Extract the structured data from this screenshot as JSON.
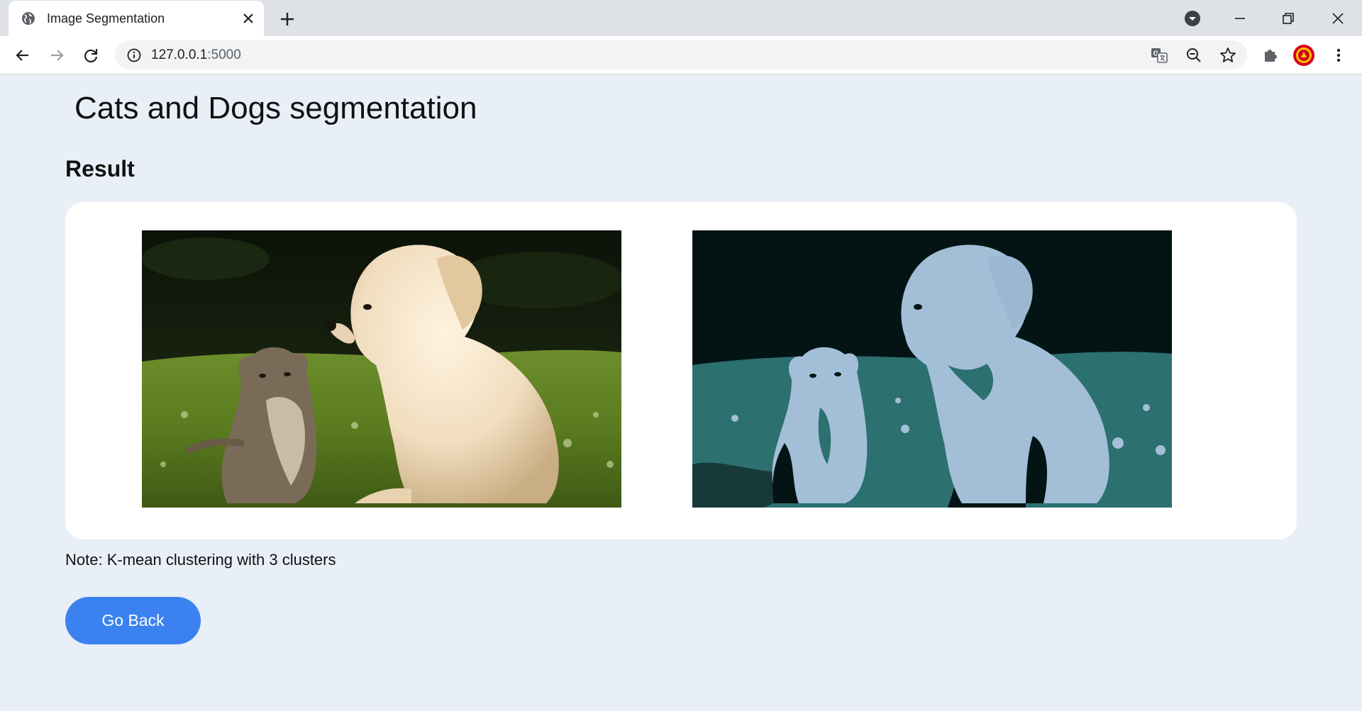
{
  "browser": {
    "tab": {
      "title": "Image Segmentation"
    },
    "address": {
      "host": "127.0.0.1",
      "port": ":5000"
    }
  },
  "page": {
    "title": "Cats and Dogs segmentation",
    "section_title": "Result",
    "original_image": {
      "subject": "kitten and labrador puppy on grass"
    },
    "segmented_image": {
      "subject": "k-means segmentation of the same photo",
      "cluster_colors": [
        "#041414",
        "#2c7070",
        "#a3bfd8"
      ]
    },
    "note": "Note: K-mean clustering with 3 clusters",
    "back_button_label": "Go Back"
  }
}
